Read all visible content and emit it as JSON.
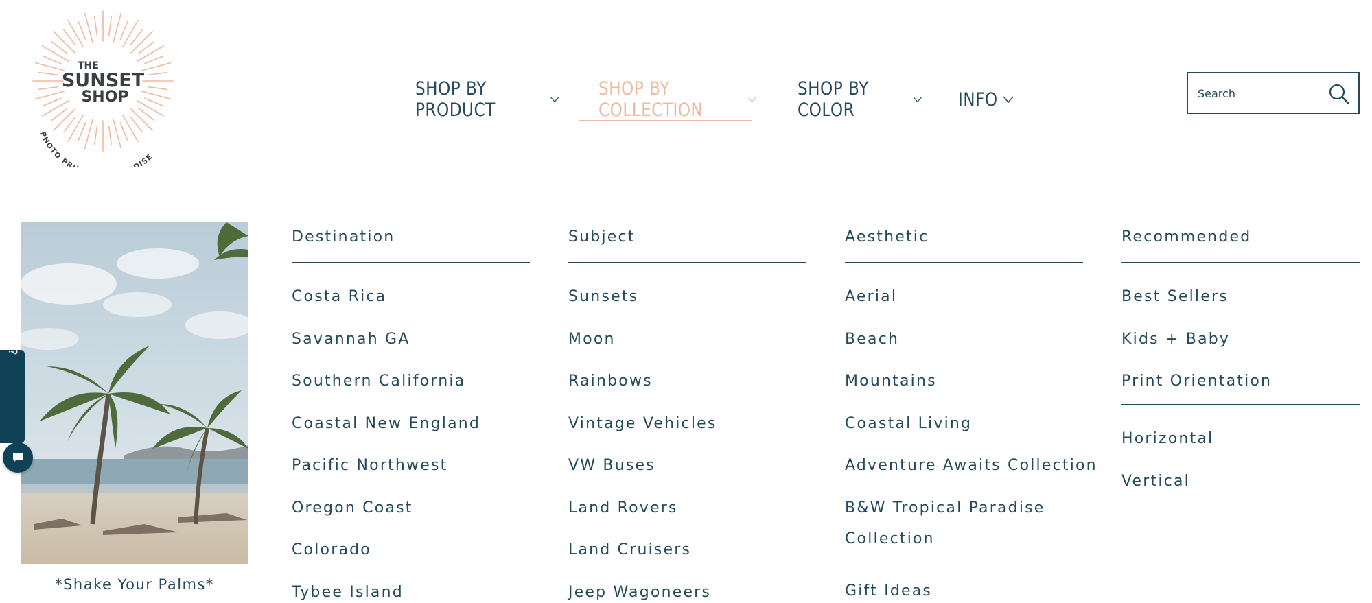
{
  "brand": {
    "logo_top": "THE",
    "logo_main1": "SUNSET",
    "logo_main2": "SHOP",
    "logo_tagline": "PHOTO PRINTS OF PARADISE",
    "accent_color": "#efb9a0",
    "text_color": "#244a5c"
  },
  "nav": {
    "items": [
      {
        "label": "SHOP BY PRODUCT",
        "icon": "chevron-down-icon"
      },
      {
        "label": "SHOP BY COLLECTION",
        "icon": "chevron-down-icon",
        "active": true
      },
      {
        "label": "SHOP BY COLOR",
        "icon": "chevron-down-icon"
      },
      {
        "label": "INFO",
        "icon": "chevron-down-icon"
      }
    ]
  },
  "search": {
    "placeholder": "Search",
    "icon": "search-icon"
  },
  "promo": {
    "caption": "*Shake Your Palms*"
  },
  "menu": {
    "columns": [
      {
        "heading": "Destination",
        "items": [
          "Costa Rica",
          "Savannah GA",
          "Southern California",
          "Coastal New England",
          "Pacific Northwest",
          "Oregon Coast",
          "Colorado",
          "Tybee Island"
        ]
      },
      {
        "heading": "Subject",
        "items": [
          "Sunsets",
          "Moon",
          "Rainbows",
          "Vintage Vehicles",
          "VW Buses",
          "Land Rovers",
          "Land Cruisers",
          "Jeep Wagoneers"
        ]
      },
      {
        "heading": "Aesthetic",
        "items": [
          "Aerial",
          "Beach",
          "Mountains",
          "Coastal Living",
          "Adventure Awaits Collection",
          "B&W Tropical Paradise",
          "Collection",
          "Gift Ideas"
        ]
      },
      {
        "heading": "Recommended",
        "items": [
          "Best Sellers",
          "Kids + Baby"
        ],
        "subheading": "Print Orientation",
        "subitems": [
          "Horizontal",
          "Vertical"
        ]
      }
    ]
  },
  "questions": {
    "label": "Questions?",
    "icon": "chat-icon"
  }
}
